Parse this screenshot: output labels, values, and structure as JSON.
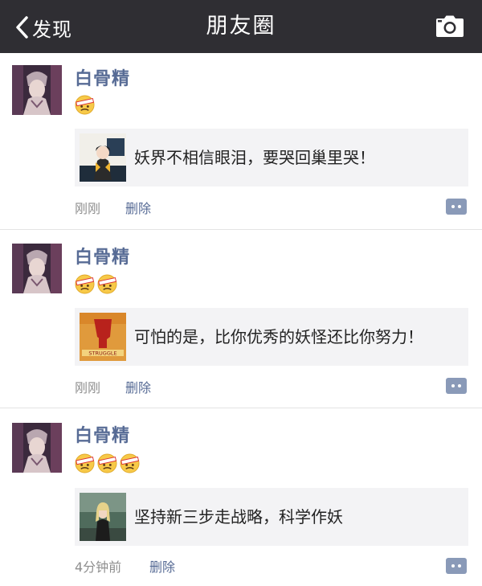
{
  "navbar": {
    "back_label": "发现",
    "title": "朋友圈",
    "back_icon": "chevron-left-icon",
    "camera_icon": "camera-icon"
  },
  "posts": [
    {
      "username": "白骨精",
      "emoji_count": 1,
      "emoji_name": "sick-face-with-bandage-emoji",
      "link_text": "妖界不相信眼泪，要哭回巢里哭！",
      "thumb": "cartoon-girl-thumbnail",
      "time": "刚刚",
      "delete_label": "删除"
    },
    {
      "username": "白骨精",
      "emoji_count": 2,
      "emoji_name": "sick-face-with-bandage-emoji",
      "link_text": "可怕的是，比你优秀的妖怪还比你努力！",
      "thumb": "struggle-poster-thumbnail",
      "thumb_text": "STRUGGLE",
      "time": "刚刚",
      "delete_label": "删除"
    },
    {
      "username": "白骨精",
      "emoji_count": 3,
      "emoji_name": "sick-face-with-bandage-emoji",
      "link_text": "坚持新三步走战略，科学作妖",
      "thumb": "woman-outdoors-thumbnail",
      "time": "4分钟前",
      "delete_label": "删除"
    }
  ],
  "colors": {
    "navbar_bg": "#2f2e33",
    "link_blue": "#576b95",
    "card_bg": "#f3f3f5",
    "meta_gray": "#8e8e8e"
  }
}
